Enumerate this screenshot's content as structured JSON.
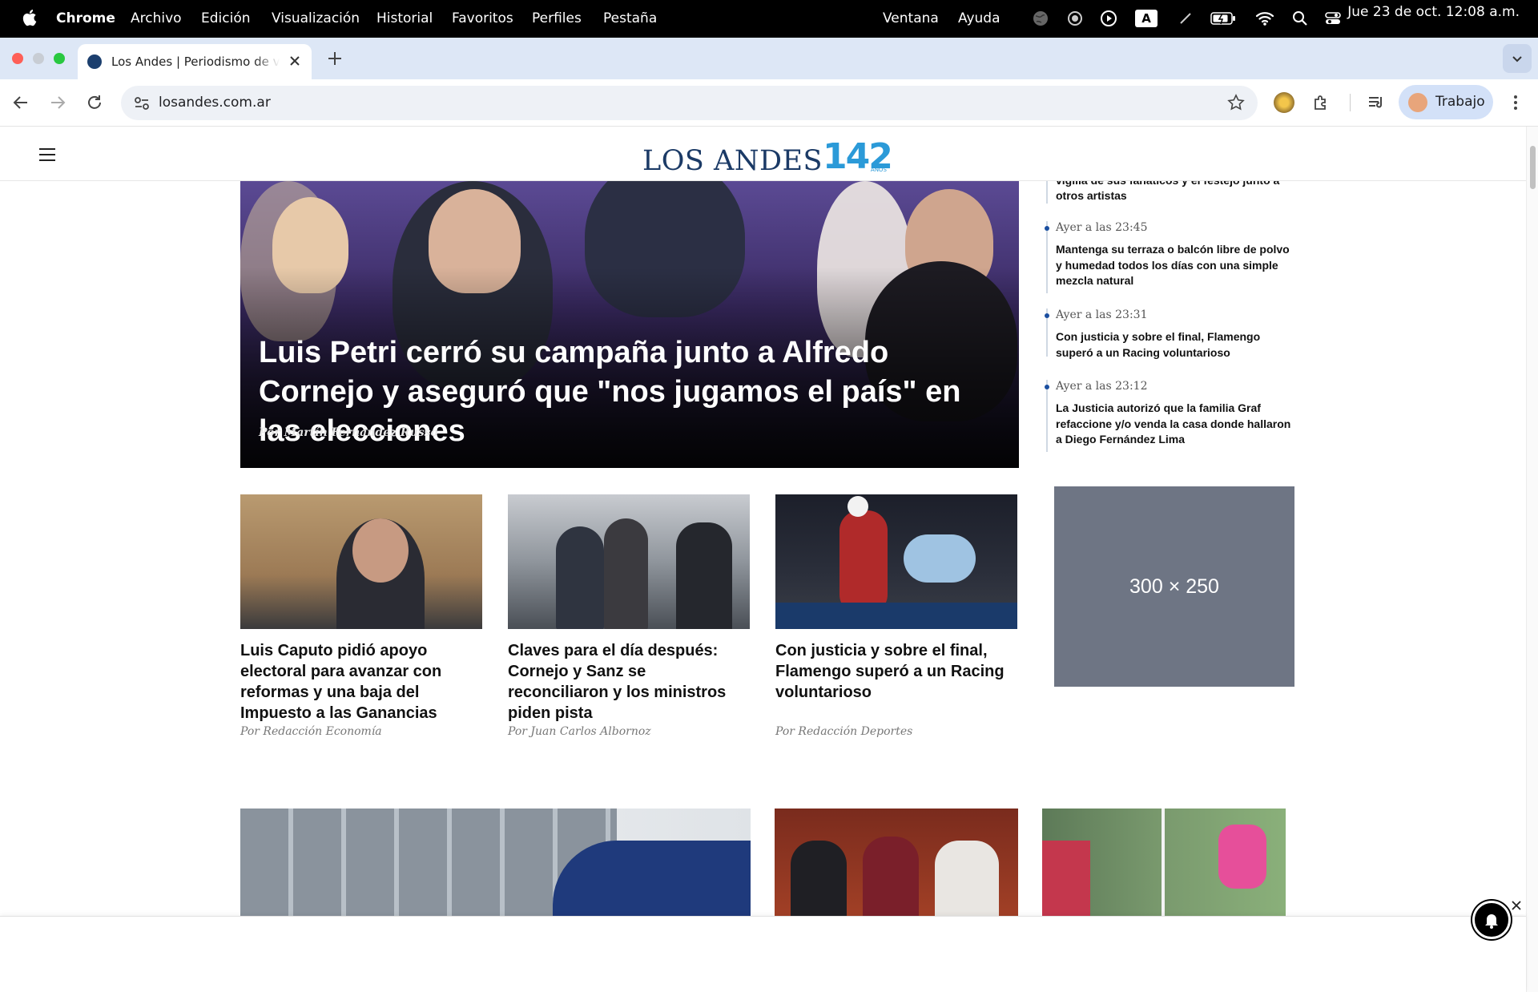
{
  "menubar": {
    "app_name": "Chrome",
    "items": [
      "Archivo",
      "Edición",
      "Visualización",
      "Historial",
      "Favoritos",
      "Perfiles",
      "Pestaña",
      "Ventana",
      "Ayuda"
    ],
    "clock": "Jue 23 de oct. 12:08 a.m.",
    "input_indicator": "A"
  },
  "browser": {
    "tab_title": "Los Andes | Periodismo de verdad",
    "url": "losandes.com.ar",
    "profile_label": "Trabajo"
  },
  "site": {
    "logo_text": "LOS ANDES",
    "logo_years": "142",
    "logo_years_suffix": "AÑOS"
  },
  "hero": {
    "headline": "Luis Petri cerró su campaña junto a Alfredo Cornejo y aseguró que \"nos jugamos el país\" en las elecciones",
    "byline": "Por Martín Fernández Russo"
  },
  "latest": {
    "cut_text": "vigilia de sus fanáticos y el festejo junto a otros artistas",
    "items": [
      {
        "time": "Ayer a las 23:45",
        "text": "Mantenga su terraza o balcón libre de polvo y humedad todos los días con una simple mezcla natural"
      },
      {
        "time": "Ayer a las 23:31",
        "text": "Con justicia y sobre el final, Flamengo superó a un Racing voluntarioso"
      },
      {
        "time": "Ayer a las 23:12",
        "text": "La Justicia autorizó que la familia Graf refaccione y/o venda la casa donde hallaron a Diego Fernández Lima"
      }
    ]
  },
  "ad": {
    "label": "300 × 250"
  },
  "cards": [
    {
      "headline": "Luis Caputo pidió apoyo electoral para avanzar con reformas y una baja del Impuesto a las Ganancias",
      "byline": "Por Redacción Economía"
    },
    {
      "headline": "Claves para el día después: Cornejo y Sanz se reconciliaron y los ministros piden pista",
      "byline": "Por Juan Carlos Albornoz"
    },
    {
      "headline": "Con justicia y sobre el final, Flamengo superó a un Racing voluntarioso",
      "byline": "Por Redacción Deportes"
    }
  ],
  "colors": {
    "brand_navy": "#1b3a66",
    "brand_blue": "#2b9ad8",
    "tabstrip": "#dde7f6",
    "ad_gray": "#6e7584"
  }
}
